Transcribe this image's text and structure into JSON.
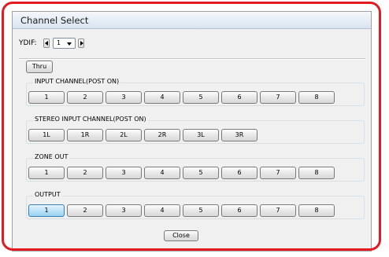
{
  "dialog": {
    "title": "Channel Select",
    "ydif": {
      "label": "YDIF:",
      "selected": "1"
    },
    "thru_label": "Thru",
    "groups": [
      {
        "label": "INPUT CHANNEL(POST ON)",
        "buttons": [
          "1",
          "2",
          "3",
          "4",
          "5",
          "6",
          "7",
          "8"
        ],
        "selected_index": null
      },
      {
        "label": "STEREO INPUT CHANNEL(POST ON)",
        "buttons": [
          "1L",
          "1R",
          "2L",
          "2R",
          "3L",
          "3R"
        ],
        "selected_index": null
      },
      {
        "label": "ZONE OUT",
        "buttons": [
          "1",
          "2",
          "3",
          "4",
          "5",
          "6",
          "7",
          "8"
        ],
        "selected_index": null
      },
      {
        "label": "OUTPUT",
        "buttons": [
          "1",
          "2",
          "3",
          "4",
          "5",
          "6",
          "7",
          "8"
        ],
        "selected_index": 0
      }
    ],
    "close_label": "Close"
  },
  "colors": {
    "annotation_frame": "#e21b23",
    "selected_button": "#98cfef"
  }
}
